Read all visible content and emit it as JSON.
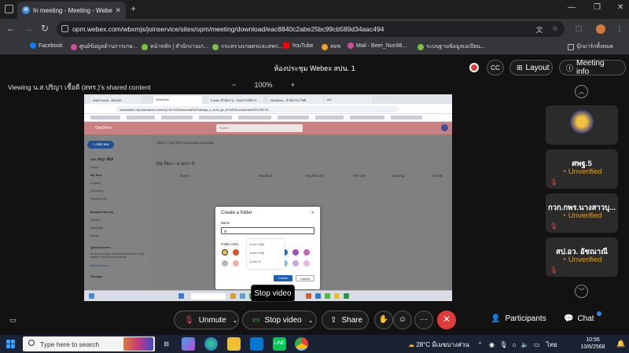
{
  "browser": {
    "tab_title": "In meeting - Meeting - Webe",
    "tab_icon_text": "W",
    "url": "opm.webex.com/wbxmjs/joinservice/sites/opm/meeting/download/eac8840c2abe25bc99cb589d34aac494",
    "bookmarks": [
      {
        "label": "Facebook",
        "color": "#1877f2"
      },
      {
        "label": "ศูนย์ข้อมูลด้านการเกษ...",
        "color": "#d04a9b"
      },
      {
        "label": "หน้าหลัก | สำนักงานเก...",
        "color": "#7ac142"
      },
      {
        "label": "กระทรวงเกษตรและสหก...",
        "color": "#7ac142"
      },
      {
        "label": "YouTube",
        "color": "#ff0000"
      },
      {
        "label": "สยช",
        "color": "#f0a020"
      },
      {
        "label": "Mail - Beer_Nun98...",
        "color": "#d04a9b"
      },
      {
        "label": "ระบบฐานข้อมูลเยเบียน...",
        "color": "#7ac142"
      }
    ],
    "other_bookmarks": "บุ๊กมาร์กทั้งหมด"
  },
  "webex": {
    "meeting_title": "ห้องประชุม Webex สปน. 1",
    "layout_label": "Layout",
    "meeting_info_label": "Meeting info",
    "share_label": "Viewing น.ส.ปริญา เชื้อดี (สทร.)'s shared content",
    "zoom_minus": "−",
    "zoom_level": "100%",
    "zoom_plus": "+",
    "participants": [
      {
        "name": "",
        "status": ""
      },
      {
        "name": "ศพฐ.5",
        "status": "Unverified"
      },
      {
        "name": "กวก.กพร.นางสาวบุ...",
        "status": "Unverified"
      },
      {
        "name": "สป.อว. อัชณาณี",
        "status": "Unverified"
      }
    ],
    "tooltip": "Stop video",
    "controls": {
      "unmute": "Unmute",
      "stop_video": "Stop video",
      "share": "Share",
      "participants": "Participants",
      "chat": "Chat"
    }
  },
  "shared": {
    "tabs": [
      "Web Portal - สปน.69",
      "OneDrive",
      "Folder สำนักงาน - กองการบริหาร",
      "Workflow - สำนักงาน ไซต์",
      "Ink"
    ],
    "url": "workadmin-my.sharepoint.com/my?id=%2Fpersonal%2Fsaraya_s_com_go_th%2FDocuments%2Fมาตรา9",
    "app_name": "OneDrive",
    "search_placeholder": "Search",
    "add_new": "+ Add new",
    "user_name": "น.ส. ปริญา เชื้อดี",
    "nav": [
      "Home",
      "My files",
      "Shared",
      "Favorites",
      "Recycle bin"
    ],
    "browse_hdr": "Browse files by",
    "browse": [
      "People",
      "Meetings",
      "Media"
    ],
    "quick_hdr": "Quick access",
    "quick_text": "As you open files from shared libraries, they'll appear in the Quick access list",
    "more_places": "More places...",
    "storage": "Storage",
    "commands": "Share   Copy link   Download   Automate",
    "crumb": "My files  ›  มาตรา 9",
    "columns": [
      "Name",
      "Modified",
      "Modified By",
      "File size",
      "Sharing",
      "Activity"
    ],
    "empty_text": "Drag files here to upload or click the New button",
    "dialog": {
      "title": "Create a folder",
      "close": "✕",
      "name_label": "Name",
      "name_value": "ห",
      "suggestions": [
        "มาตรา 9(2)",
        "มาตรา 9(3)",
        "มาตรา 9"
      ],
      "color_label": "Folder color",
      "create": "Create",
      "cancel": "Cancel"
    }
  },
  "taskbar": {
    "search_placeholder": "Type here to search",
    "weather": "28°C  มีเมฆบางส่วน",
    "lang": "ไทย",
    "time": "10:56",
    "date": "10/6/2568"
  }
}
